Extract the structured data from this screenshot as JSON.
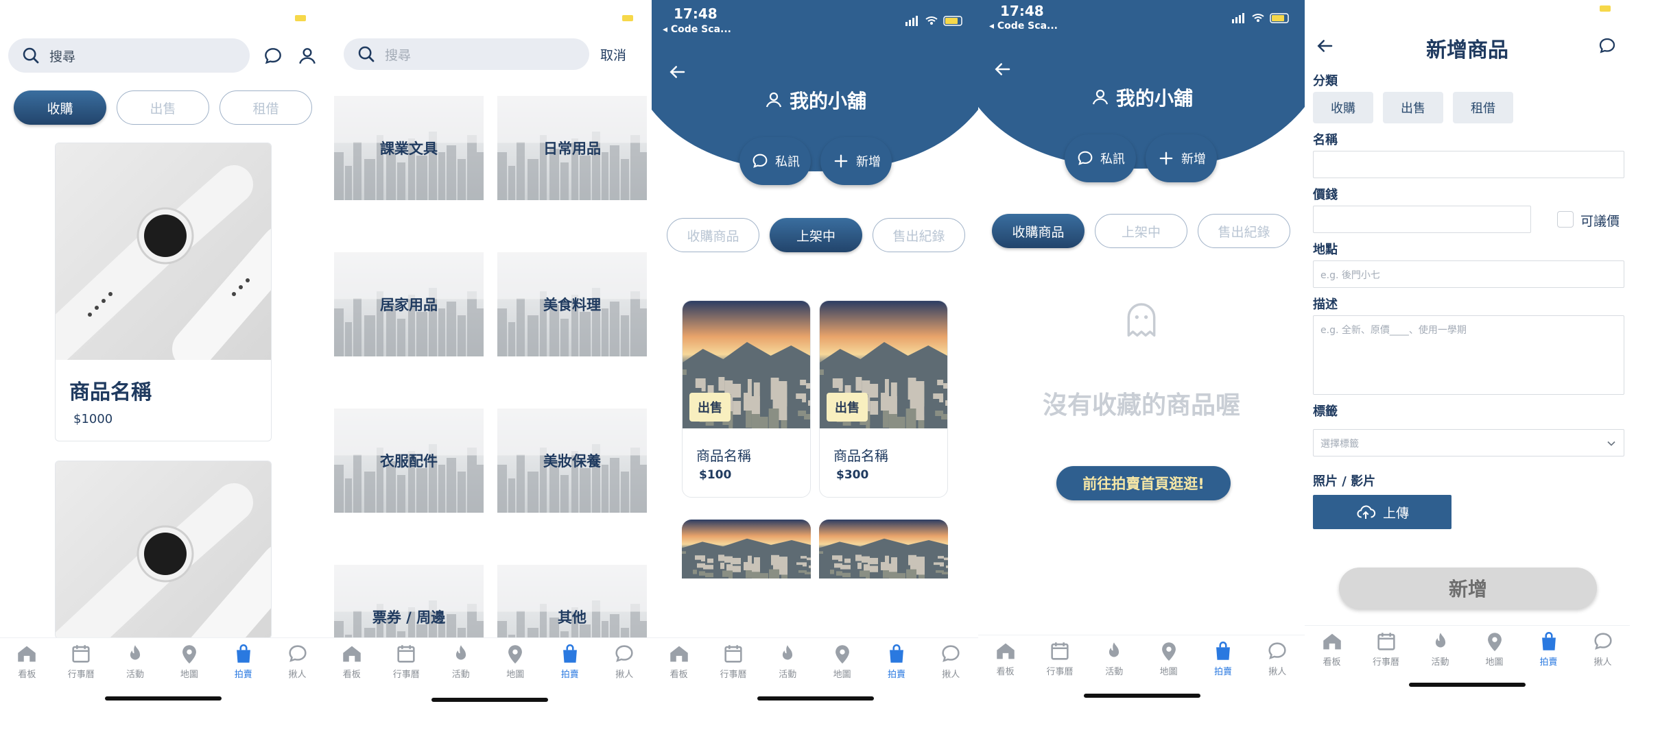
{
  "nav": {
    "items": [
      {
        "label": "看板",
        "icon": "home-icon"
      },
      {
        "label": "行事曆",
        "icon": "calendar-icon"
      },
      {
        "label": "活動",
        "icon": "fire-icon"
      },
      {
        "label": "地圖",
        "icon": "map-pin-icon"
      },
      {
        "label": "拍賣",
        "icon": "shopping-bag-icon"
      },
      {
        "label": "揪人",
        "icon": "chat-icon"
      }
    ],
    "active_index": 4
  },
  "screen1": {
    "search_value": "搜尋",
    "tabs": [
      "收購",
      "出售",
      "租借"
    ],
    "active_tab": 0,
    "products": [
      {
        "name": "商品名稱",
        "price": "$1000"
      },
      {
        "name": "",
        "price": ""
      }
    ]
  },
  "screen2": {
    "search_placeholder": "搜尋",
    "cancel": "取消",
    "categories": [
      "課業文具",
      "日常用品",
      "居家用品",
      "美食料理",
      "衣服配件",
      "美妝保養",
      "票券 / 周邊",
      "其他"
    ]
  },
  "screen3": {
    "time": "17:48",
    "back_app": "◂ Code Sca...",
    "title": "我的小舖",
    "msg_btn": "私訊",
    "add_btn": "新增",
    "tabs": [
      "收購商品",
      "上架中",
      "售出紀錄"
    ],
    "active_tab": 1,
    "items": [
      {
        "tag": "出售",
        "name": "商品名稱",
        "price": "$100"
      },
      {
        "tag": "出售",
        "name": "商品名稱",
        "price": "$300"
      }
    ]
  },
  "screen4": {
    "time": "17:48",
    "back_app": "◂ Code Sca...",
    "title": "我的小舖",
    "msg_btn": "私訊",
    "add_btn": "新增",
    "tabs": [
      "收購商品",
      "上架中",
      "售出紀錄"
    ],
    "active_tab": 0,
    "empty_text": "沒有收藏的商品喔",
    "cta": "前往拍賣首頁逛逛!"
  },
  "screen5": {
    "title": "新增商品",
    "category_label": "分類",
    "categories": [
      "收購",
      "出售",
      "租借"
    ],
    "name_label": "名稱",
    "name_value": "",
    "price_label": "價錢",
    "price_value": "",
    "negotiable": "可議價",
    "location_label": "地點",
    "location_placeholder": "e.g. 後門小七",
    "desc_label": "描述",
    "desc_placeholder": "e.g. 全新、原價____、使用一學期",
    "tags_label": "標籤",
    "tags_placeholder": "選擇標籤",
    "media_label": "照片 / 影片",
    "upload": "上傳",
    "submit": "新增"
  },
  "colors": {
    "brand": "#2f5f8f",
    "accent_blue": "#2a79e0",
    "tag_yellow": "#f8efbf"
  }
}
